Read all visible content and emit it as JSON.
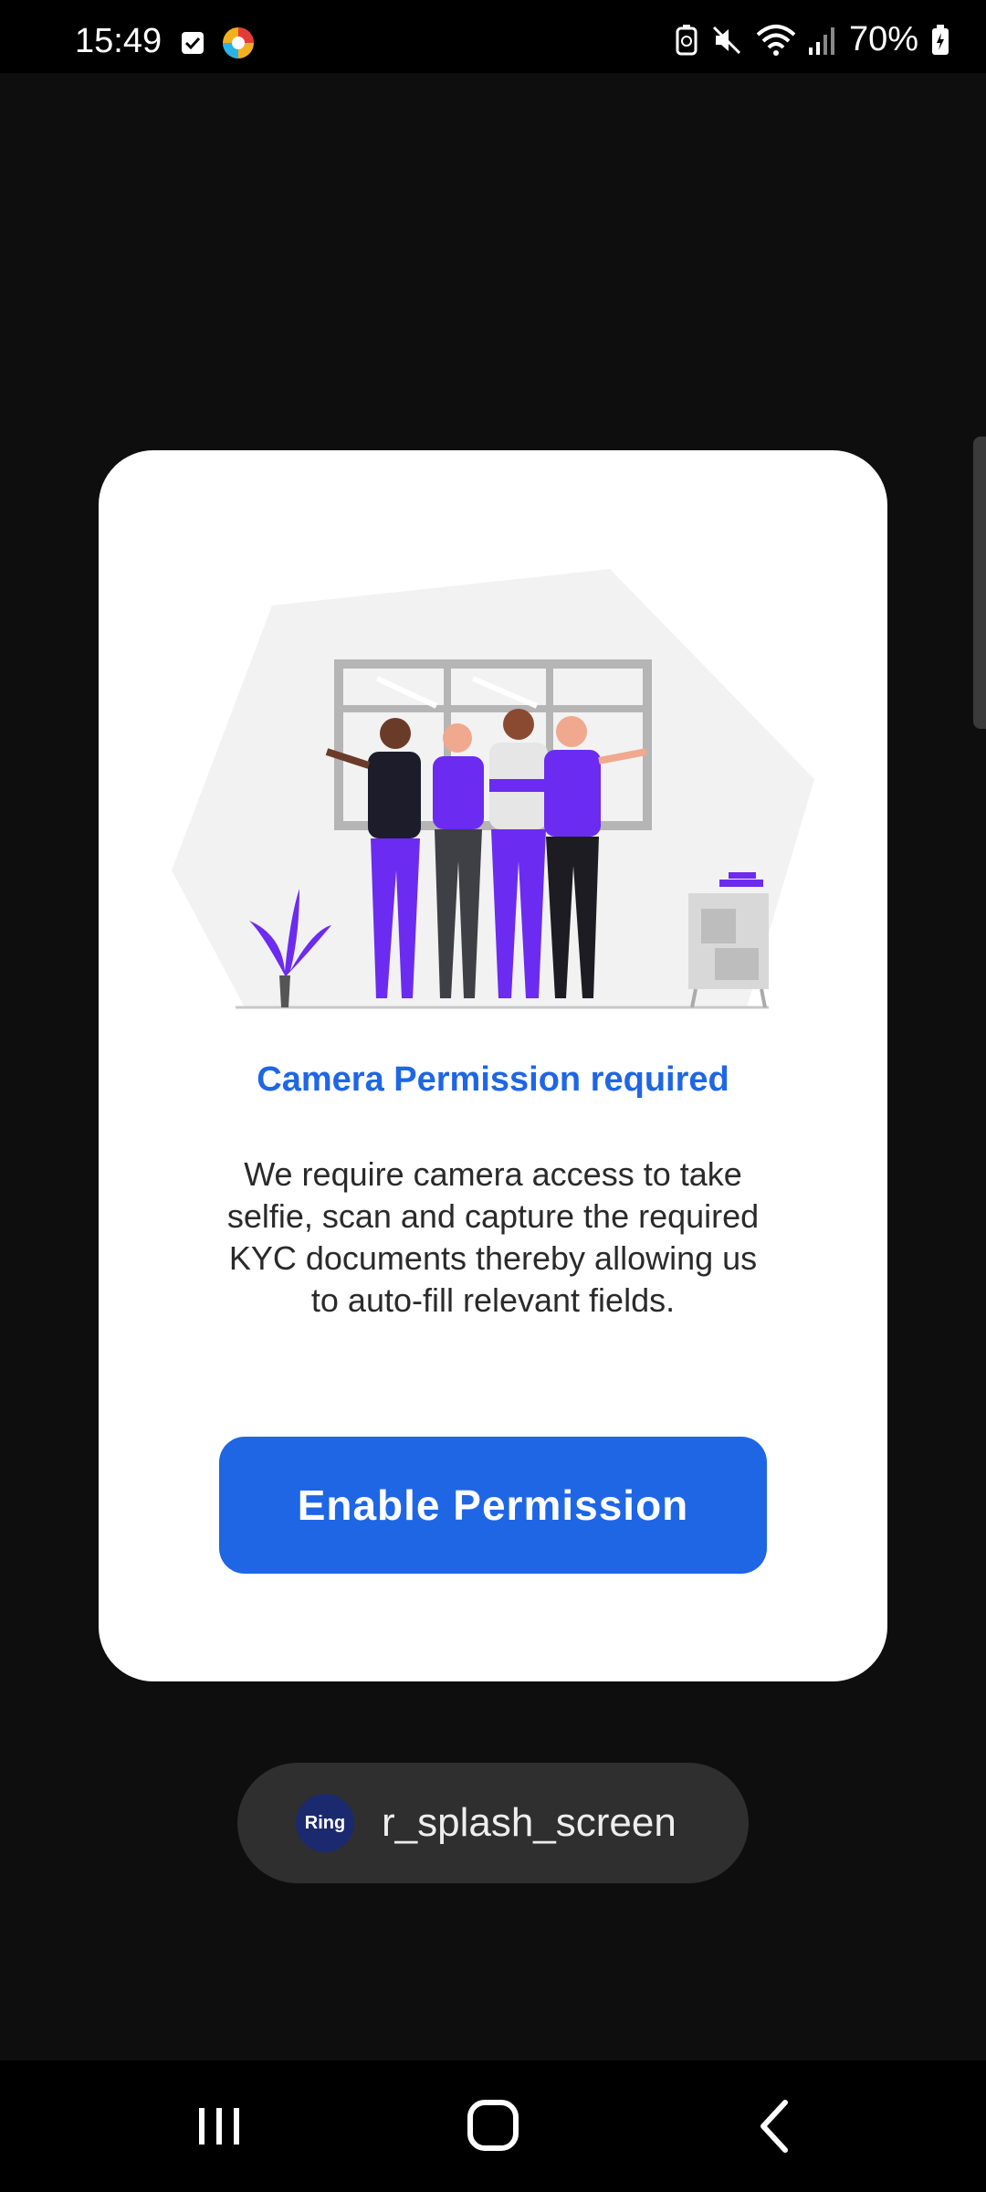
{
  "status_bar": {
    "time": "15:49",
    "battery": "70%",
    "icons": [
      "checkbox-icon",
      "app-color-icon",
      "recycle-icon",
      "mute-icon",
      "wifi-icon",
      "signal-icon",
      "battery-icon"
    ]
  },
  "dialog": {
    "title": "Camera Permission required",
    "description": "We require camera access to take selfie, scan and capture the required KYC documents thereby allowing us to auto-fill relevant fields.",
    "button_label": "Enable Permission",
    "accent_color": "#1f66e5"
  },
  "toast": {
    "logo_text": "Ring",
    "text": "r_splash_screen"
  },
  "nav_bar": {
    "icons": [
      "recents-icon",
      "home-icon",
      "back-icon"
    ]
  }
}
